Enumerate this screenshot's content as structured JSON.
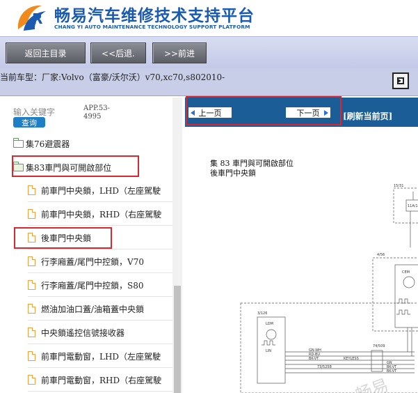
{
  "header": {
    "title": "畅易汽车维修技术支持平台",
    "subtitle": "CHANG YI AUTO MAINTENANCE TECHNOLOGY SUPPORT PLATFORM"
  },
  "nav": {
    "home": "返回主目录",
    "back": "<<后退.",
    "forward": ">>前进"
  },
  "model": {
    "label": "当前车型：",
    "value": "厂家:Volvo（富豪/沃尔沃）v70,xc70,s802010-"
  },
  "search": {
    "label": "输入关键字",
    "button": "查询",
    "app_label": "APP.53-4995"
  },
  "tree": {
    "folders": [
      {
        "label": "集76避震器"
      },
      {
        "label": "集83車門與可開啟部位"
      }
    ],
    "items": [
      {
        "label": "前車門中央鎖，LHD（左座駕駛"
      },
      {
        "label": "前車門中央鎖，RHD（右座駕駛"
      },
      {
        "label": "後車門中央鎖"
      },
      {
        "label": "行李廂蓋/尾門中控鎖，V70"
      },
      {
        "label": "行李廂蓋/尾門中控鎖，S80"
      },
      {
        "label": "燃油加油口蓋/油箱蓋中央鎖"
      },
      {
        "label": "中央鎖遙控信號接收器"
      },
      {
        "label": "前車門電動窗，LHD（左座駕駛"
      },
      {
        "label": "前車門電動窗，RHD（右座駕駛"
      }
    ]
  },
  "pager": {
    "prev": "上一页",
    "next": "下一页",
    "refresh": "[刷新当前页]"
  },
  "document": {
    "line1": "集 83 車門與可開啟部位",
    "line2": "後車門中央鎖"
  },
  "diagram": {
    "labels": {
      "a": "15/31",
      "b": "11A/1",
      "c": "4/56",
      "d": "CEM",
      "e": "3/126",
      "f": "LDM",
      "g": "74/509",
      "h": "GN-WH",
      "i": "RD-BU",
      "j": "BK-VT",
      "k": "KEYLESS",
      "l": "73/5258",
      "m": "LIN",
      "n": "GN",
      "o": "BK-VT",
      "p": "BK-VT"
    }
  },
  "watermark": "畅易",
  "colors": {
    "brand_blue": "#1a5bb0",
    "pager_blue": "#1b5e97",
    "highlight_red": "#d9262f"
  }
}
